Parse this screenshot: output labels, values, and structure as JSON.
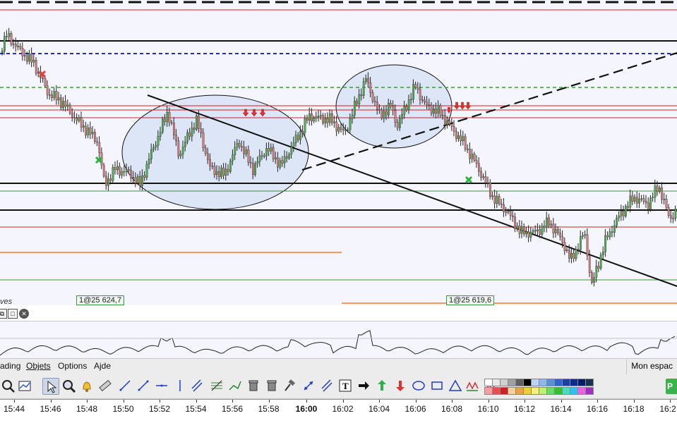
{
  "order_tags": {
    "first": "1@25 624,7",
    "second": "1@25 619,6"
  },
  "left_label": "ves",
  "menu": {
    "trading": "ading",
    "objects": "Objets",
    "options": "Options",
    "help": "Ajde"
  },
  "workspace_label": "Mon espac",
  "green_button_label": "P",
  "time_axis": {
    "labels": [
      "15:44",
      "15:46",
      "15:48",
      "15:50",
      "15:52",
      "15:54",
      "15:56",
      "15:58",
      "16:00",
      "16:02",
      "16:04",
      "16:06",
      "16:08",
      "16:10",
      "16:12",
      "16:14",
      "16:16",
      "16:18",
      "16:2"
    ],
    "bold_label": "16:00"
  },
  "colors": {
    "bull_candle": "#4fae4f",
    "bear_candle": "#d77a7a",
    "chart_bg": "#f5f6fd",
    "ellipse_fill": "#dde6f7",
    "resistance_red": "#d42020",
    "support_green": "#2e9a2e",
    "dashed_blue": "#1f2ec8",
    "dashed_green": "#2ea32e",
    "orange_line": "#f07a30"
  },
  "toolbar": {
    "tools": [
      "zoom-search-icon",
      "chart-settings-icon",
      "pointer-icon",
      "magnifier-icon",
      "alert-bell-icon",
      "ruler-icon",
      "ray-icon",
      "trendline-icon",
      "horizontal-line-icon",
      "vertical-line-icon",
      "channel-icon",
      "fibonacci-icon",
      "andrews-pitchfork-icon",
      "eraser-icon",
      "trash-icon",
      "hammer-icon",
      "expand-icon",
      "parallel-lines-icon",
      "text-icon",
      "arrow-right-icon",
      "arrow-up-icon",
      "arrow-down-icon",
      "ellipse-icon",
      "rectangle-icon",
      "triangle-icon",
      "wave-icon",
      "zigzag-icon"
    ],
    "palette_row1": [
      "#ffffff",
      "#e8e8e8",
      "#d0d0d0",
      "#a0a0a0",
      "#606060",
      "#000000",
      "#bcd4f4",
      "#8fb6ee",
      "#5a8fe0",
      "#2f64d2",
      "#1c3fb0",
      "#0f2a8e",
      "#081a6a",
      "#1b2f4e"
    ],
    "palette_row2": [
      "#f4a0a0",
      "#e85050",
      "#d02020",
      "#f8d0a0",
      "#f0a040",
      "#f0d030",
      "#f8f070",
      "#c0f070",
      "#60e060",
      "#30c030",
      "#40e0c0",
      "#30c0f0",
      "#f060e0",
      "#a030c0"
    ]
  }
}
